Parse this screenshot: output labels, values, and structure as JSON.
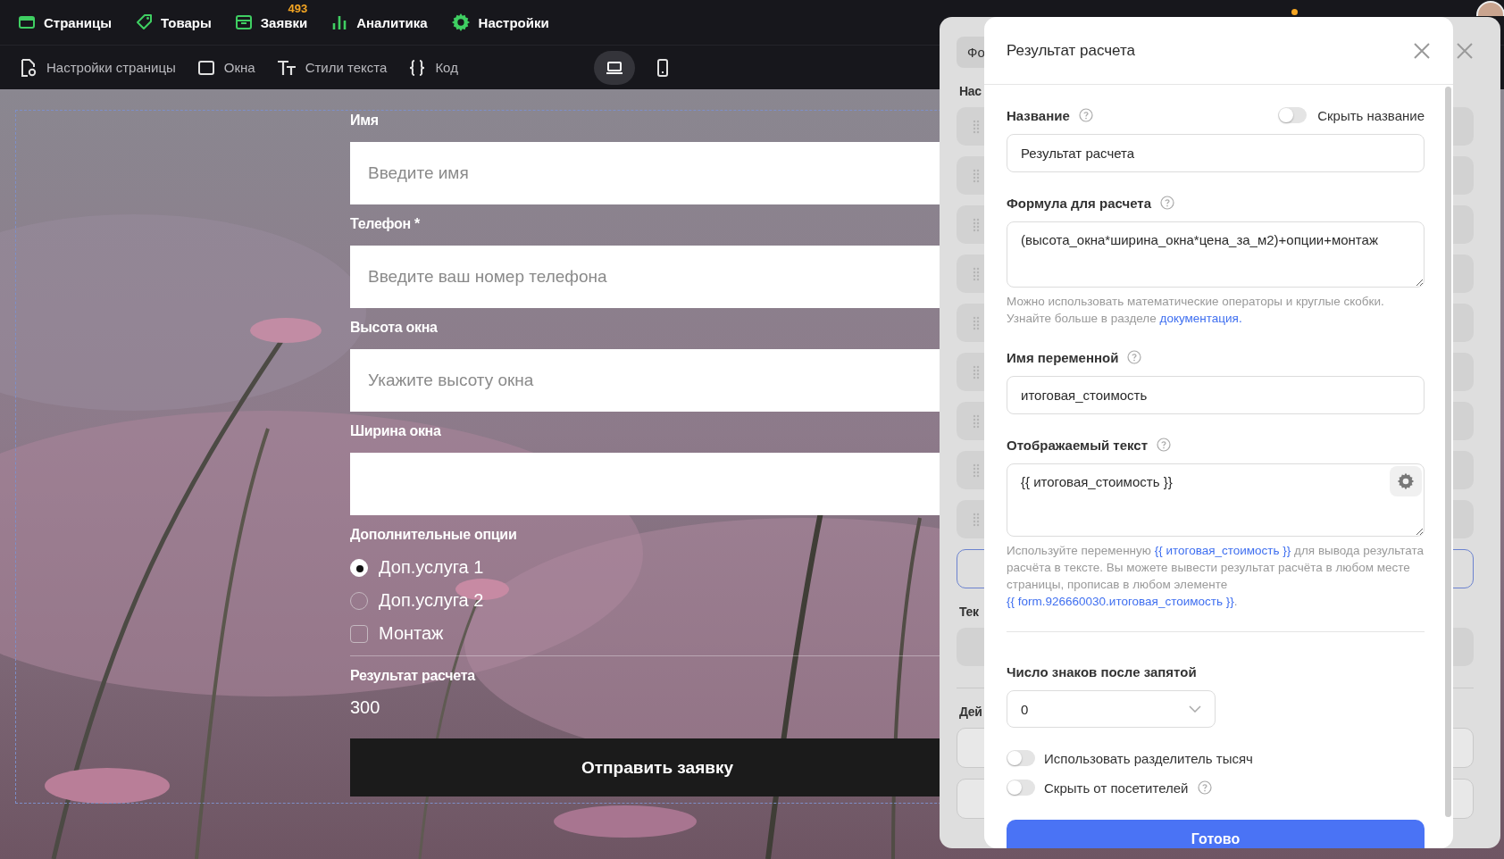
{
  "top_nav": [
    {
      "label": "Страницы"
    },
    {
      "label": "Товары"
    },
    {
      "label": "Заявки",
      "badge": "493"
    },
    {
      "label": "Аналитика"
    },
    {
      "label": "Настройки"
    }
  ],
  "toolbar": [
    {
      "label": "Настройки страницы"
    },
    {
      "label": "Окна"
    },
    {
      "label": "Стили текста"
    },
    {
      "label": "Код"
    }
  ],
  "view_toggle": [
    {
      "selected": true
    },
    {
      "selected": false
    }
  ],
  "form": {
    "fields": [
      {
        "label": "Имя",
        "placeholder": "Введите имя"
      },
      {
        "label": "Телефон *",
        "placeholder": "Введите ваш номер телефона"
      },
      {
        "label": "Высота окна",
        "placeholder": "Укажите высоту окна"
      },
      {
        "label": "Ширина окна"
      }
    ],
    "options_label": "Дополнительные опции",
    "options": [
      {
        "kind": "radio",
        "label": "Доп.услуга 1",
        "selected": true
      },
      {
        "kind": "radio",
        "label": "Доп.услуга 2",
        "selected": false
      },
      {
        "kind": "checkbox",
        "label": "Монтаж",
        "checked": false
      }
    ],
    "result_label": "Результат расчета",
    "result_value": "300",
    "submit": "Отправить заявку"
  },
  "back_panel": {
    "tab": "Фо",
    "headings": [
      "Нас",
      "Тек",
      "Дей"
    ]
  },
  "modal": {
    "title": "Результат расчета",
    "name": {
      "label": "Название",
      "help": true,
      "value": "Результат расчета",
      "hide_toggle": {
        "label": "Скрыть название",
        "on": false
      }
    },
    "formula": {
      "label": "Формула для расчета",
      "help": true,
      "value": "(высота_окна*ширина_окна*цена_за_м2)+опции+монтаж",
      "hint": [
        {
          "text": "Можно использовать математические операторы и круглые скобки. Узнайте больше в разделе "
        },
        {
          "link": "документация."
        }
      ]
    },
    "variable": {
      "label": "Имя переменной",
      "help": true,
      "value": "итоговая_стоимость"
    },
    "display": {
      "label": "Отображаемый текст",
      "help": true,
      "value": "{{ итоговая_стоимость }}",
      "hint": [
        {
          "text": "Используйте переменную "
        },
        {
          "link": "{{ итоговая_стоимость }}"
        },
        {
          "text": " для вывода результата расчёта в тексте. Вы можете вывести результат расчёта в любом месте страницы, прописав в любом элементе "
        },
        {
          "link": "{{ form.926660030.итоговая_стоимость }}"
        },
        {
          "text": "."
        }
      ]
    },
    "decimals": {
      "label": "Число знаков после запятой",
      "value": "0"
    },
    "toggles": [
      {
        "label": "Использовать разделитель тысяч",
        "on": false,
        "help": false
      },
      {
        "label": "Скрыть от посетителей",
        "on": false,
        "help": true
      }
    ],
    "done": "Готово"
  }
}
